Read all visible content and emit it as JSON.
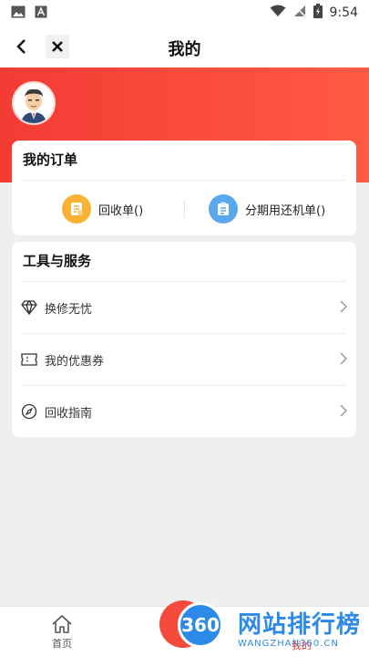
{
  "status_bar": {
    "time": "9:54"
  },
  "nav": {
    "title": "我的"
  },
  "orders": {
    "title": "我的订单",
    "items": [
      {
        "label": "回收单()",
        "icon": "document-icon"
      },
      {
        "label": "分期用还机单()",
        "icon": "clipboard-icon"
      }
    ]
  },
  "tools": {
    "title": "工具与服务",
    "items": [
      {
        "label": "换修无忧",
        "icon": "diamond-icon"
      },
      {
        "label": "我的优惠券",
        "icon": "coupon-icon"
      },
      {
        "label": "回收指南",
        "icon": "compass-icon"
      }
    ]
  },
  "tabbar": {
    "home_label": "首页",
    "mine_label": "我的"
  },
  "watermark": {
    "badge": "360",
    "text": "网站排行榜",
    "url": "WANGZHAN360.CN"
  },
  "colors": {
    "accent": "#f33b34",
    "blue": "#2d8ae8",
    "orange": "#f9b233"
  }
}
